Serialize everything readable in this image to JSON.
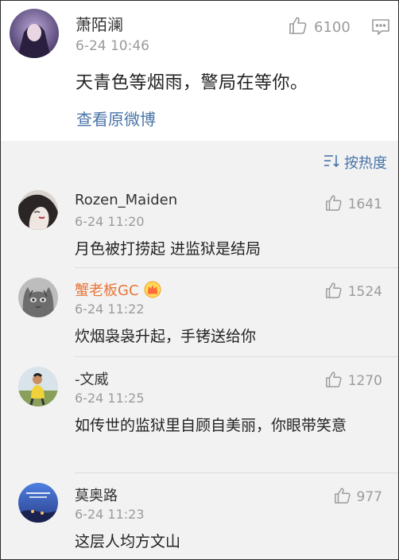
{
  "main_comment": {
    "username": "萧陌澜",
    "time": "6-24 10:46",
    "likes": "6100",
    "content": "天青色等烟雨，警局在等你。",
    "view_original": "查看原微博"
  },
  "sort": {
    "label": "按热度"
  },
  "replies": [
    {
      "username": "Rozen_Maiden",
      "time": "6-24 11:20",
      "likes": "1641",
      "content": "月色被打捞起 进监狱是结局"
    },
    {
      "username": "蟹老板GC",
      "time": "6-24 11:22",
      "likes": "1524",
      "content": "炊烟袅袅升起，手铐送给你",
      "badge_icon": "crown-icon"
    },
    {
      "username": "-文威",
      "time": "6-24 11:25",
      "likes": "1270",
      "content": "如传世的监狱里自顾自美丽，你眼带笑意"
    },
    {
      "username": "莫奥路",
      "time": "6-24 11:23",
      "likes": "977",
      "content": "这层人均方文山"
    }
  ],
  "colors": {
    "link": "#4a74a8",
    "vip_name": "#e8763a",
    "muted": "#9b9b9b",
    "list_bg": "#f2f2f2"
  }
}
